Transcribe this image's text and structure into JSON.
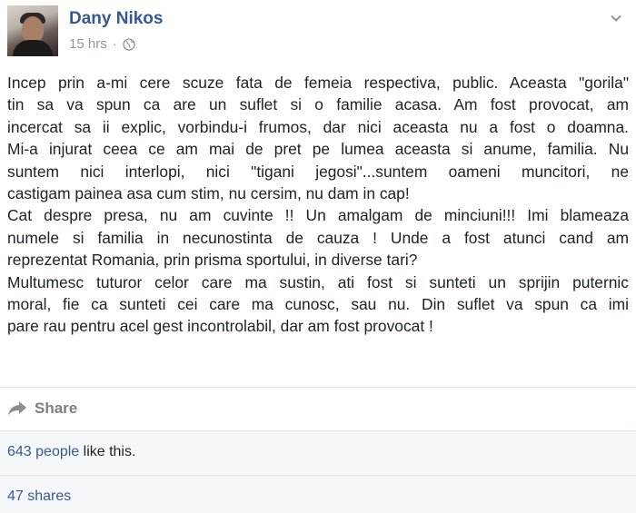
{
  "post": {
    "author": "Dany Nikos",
    "time": "15 hrs",
    "separator": "·",
    "lines": [
      "Incep prin a-mi cere scuze fata de femeia respectiva, public. Aceasta \"gorila\"",
      "tin sa va spun ca are un suflet si o familie acasa. Am fost provocat, am",
      "incercat sa ii explic, vorbindu-i frumos, dar nici aceasta nu a fost o doamna.",
      "Mi-a injurat ceea ce am mai de pret pe lumea aceasta si anume, familia. Nu",
      "suntem nici interlopi, nici \"tigani jegosi\"...suntem oameni muncitori, ne",
      "castigam painea asa cum stim, nu cersim, nu dam in cap!",
      "Cat despre presa, nu am cuvinte !! Un amalgam de minciuni!!! Imi blameaza",
      "numele si familia in necunostinta de cauza ! Unde a fost atunci cand am",
      "reprezentat Romania, prin prisma sportului, in diverse tari?",
      "Multumesc tuturor celor care ma sustin, ati fost si sunteti un sprijin puternic",
      "moral, fie ca sunteti cei care ma cunosc, sau nu. Din suflet va spun ca imi",
      "pare rau pentru acel gest incontrolabil, dar am fost provocat !"
    ]
  },
  "actions": {
    "share_label": "Share"
  },
  "reactions": {
    "likes_count": "643 people",
    "likes_suffix": " like this.",
    "shares": "47 shares"
  }
}
